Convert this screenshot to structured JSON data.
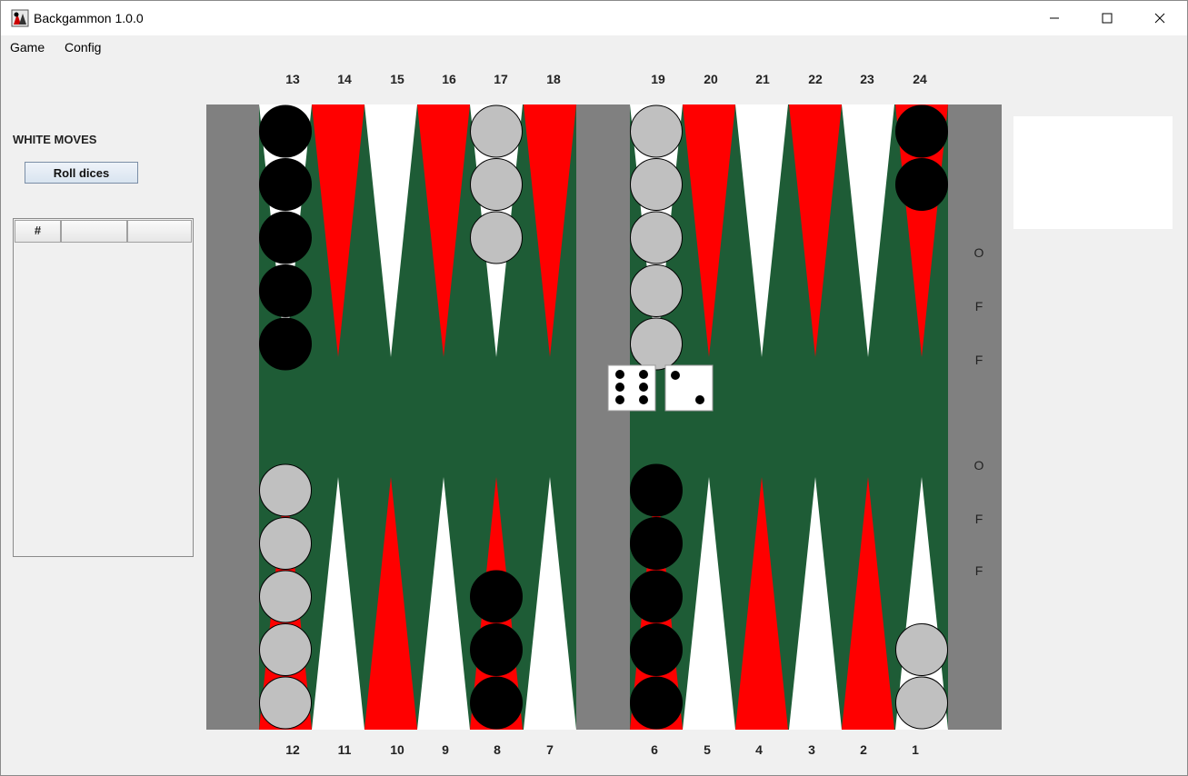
{
  "window": {
    "title": "Backgammon 1.0.0",
    "controls": [
      "minimize-icon",
      "maximize-icon",
      "close-icon"
    ]
  },
  "menu": {
    "game": "Game",
    "config": "Config"
  },
  "left_panel": {
    "turn_label": "WHITE MOVES",
    "roll_button": "Roll dices",
    "moves_table": {
      "headers": [
        "#",
        "",
        ""
      ],
      "rows": []
    }
  },
  "board": {
    "colors": {
      "felt": "#1e5c36",
      "bar": "#808080",
      "red": "#ff0000",
      "white": "#ffffff",
      "light_checker": "#c0c0c0",
      "dark_checker": "#000000"
    },
    "top_points": [
      "13",
      "14",
      "15",
      "16",
      "17",
      "18",
      "19",
      "20",
      "21",
      "22",
      "23",
      "24"
    ],
    "bottom_points": [
      "12",
      "11",
      "10",
      "9",
      "8",
      "7",
      "6",
      "5",
      "4",
      "3",
      "2",
      "1"
    ],
    "checkers": [
      {
        "point": 13,
        "color": "black",
        "count": 5
      },
      {
        "point": 17,
        "color": "white",
        "count": 3
      },
      {
        "point": 19,
        "color": "white",
        "count": 5
      },
      {
        "point": 24,
        "color": "black",
        "count": 2
      },
      {
        "point": 12,
        "color": "white",
        "count": 5
      },
      {
        "point": 8,
        "color": "black",
        "count": 3
      },
      {
        "point": 6,
        "color": "black",
        "count": 5
      },
      {
        "point": 1,
        "color": "white",
        "count": 2
      }
    ],
    "dice": [
      6,
      2
    ],
    "off_labels_upper": [
      "O",
      "F",
      "F"
    ],
    "off_labels_lower": [
      "O",
      "F",
      "F"
    ]
  }
}
